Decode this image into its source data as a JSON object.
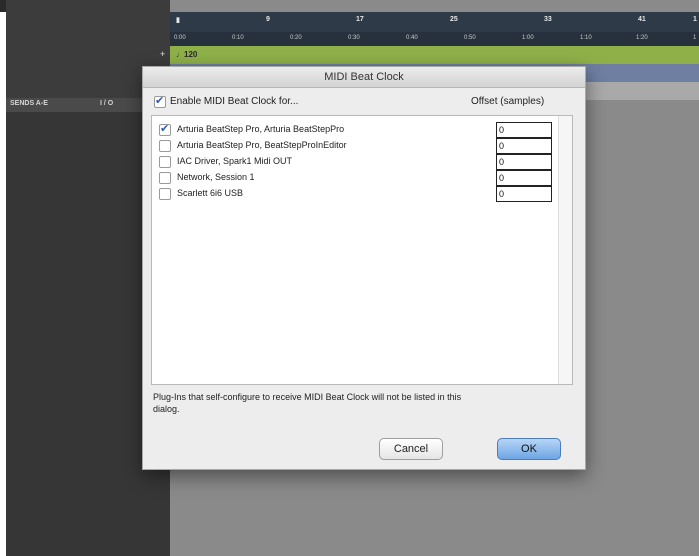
{
  "ruler": {
    "bars": [
      "9",
      "17",
      "25",
      "33",
      "41",
      "1"
    ],
    "times": [
      "0:00",
      "0:10",
      "0:20",
      "0:30",
      "0:40",
      "0:50",
      "1:00",
      "1:10",
      "1:20",
      "1"
    ]
  },
  "tempo": {
    "plus": "+",
    "value": "120"
  },
  "left_panel": {
    "sends_label": "SENDS A-E",
    "io_label": "I / O"
  },
  "dialog": {
    "title": "MIDI Beat Clock",
    "enable_label": "Enable MIDI Beat Clock for...",
    "enable_checked": true,
    "offset_header": "Offset (samples)",
    "devices": [
      {
        "label": "Arturia BeatStep Pro, Arturia BeatStepPro",
        "checked": true,
        "offset": "0"
      },
      {
        "label": "Arturia BeatStep Pro, BeatStepProInEditor",
        "checked": false,
        "offset": "0"
      },
      {
        "label": "IAC Driver, Spark1 Midi OUT",
        "checked": false,
        "offset": "0"
      },
      {
        "label": "Network, Session 1",
        "checked": false,
        "offset": "0"
      },
      {
        "label": "Scarlett 6i6 USB",
        "checked": false,
        "offset": "0"
      }
    ],
    "note": "Plug-Ins that self-configure to receive MIDI Beat Clock will not be listed in this dialog.",
    "cancel_label": "Cancel",
    "ok_label": "OK"
  },
  "colors": {
    "tempo_track": "#8fb049",
    "ok_button": "#6ea5e4",
    "checkmark": "#2b5fb3"
  }
}
